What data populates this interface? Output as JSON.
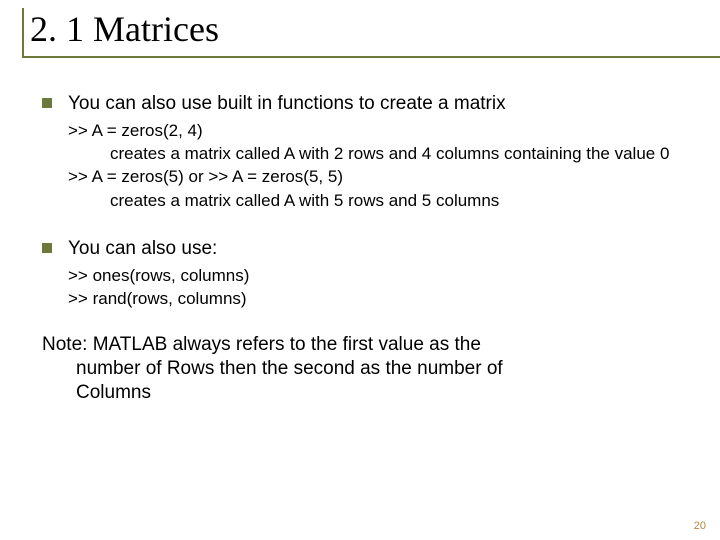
{
  "title": "2. 1 Matrices",
  "bullet1": "You can also use built in functions to create a matrix",
  "sub1a": ">> A = zeros(2, 4)",
  "sub1b": "creates a matrix called A with 2 rows and 4 columns containing the value 0",
  "sub1c": ">> A = zeros(5) or >> A = zeros(5, 5)",
  "sub1d": "creates a matrix called A with 5 rows and 5 columns",
  "bullet2": "You can also use:",
  "sub2a": ">> ones(rows, columns)",
  "sub2b": ">> rand(rows, columns)",
  "note_l1": "Note: MATLAB always refers to the first value as the",
  "note_l2": "number of Rows then the second as the number of",
  "note_l3": "Columns",
  "pagenum": "20"
}
